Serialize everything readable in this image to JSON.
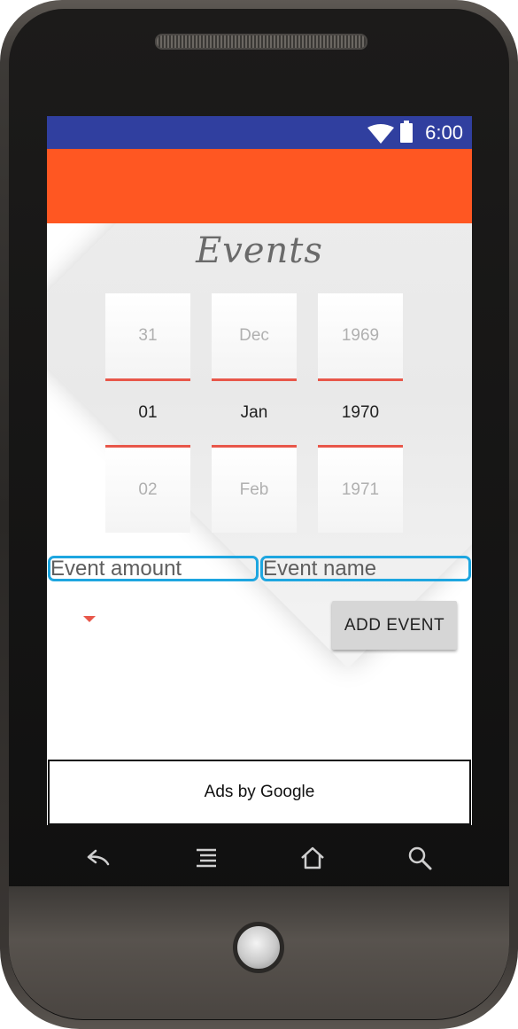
{
  "status_bar": {
    "time": "6:00",
    "wifi_icon": "wifi-icon",
    "battery_icon": "battery-icon",
    "color": "#303f9f"
  },
  "app_bar": {
    "color": "#ff5722"
  },
  "page": {
    "title": "Events"
  },
  "date_picker": {
    "day": {
      "prev": "31",
      "selected": "01",
      "next": "02"
    },
    "month": {
      "prev": "Dec",
      "selected": "Jan",
      "next": "Feb"
    },
    "year": {
      "prev": "1969",
      "selected": "1970",
      "next": "1971"
    }
  },
  "form": {
    "amount_placeholder": "Event amount",
    "name_placeholder": "Event name",
    "add_button_label": "ADD EVENT"
  },
  "ad": {
    "text": "Ads by Google"
  },
  "nav_bar": {
    "icons": [
      "back-icon",
      "menu-icon",
      "home-icon",
      "search-icon"
    ]
  },
  "colors": {
    "accent": "#e8574a",
    "focus_outline": "#1ea6e0"
  }
}
